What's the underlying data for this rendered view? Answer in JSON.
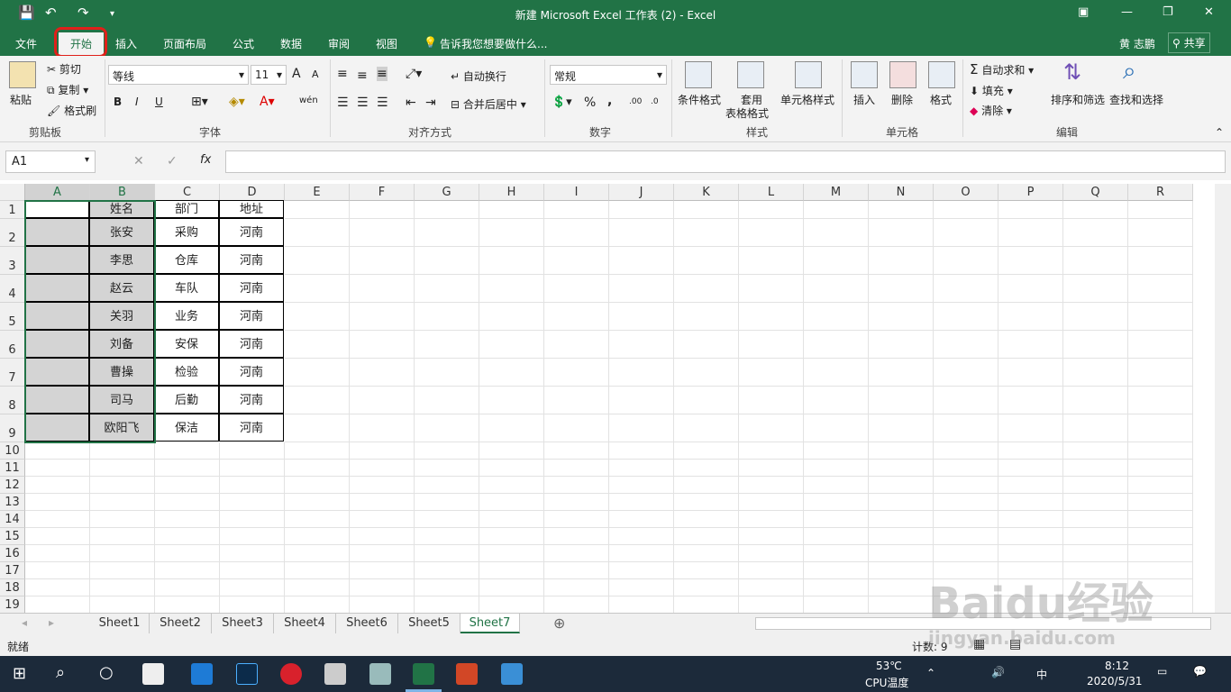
{
  "window": {
    "title": "新建 Microsoft Excel 工作表 (2) - Excel",
    "user": "黄 志鹏",
    "share": "共享"
  },
  "tabs": [
    "文件",
    "开始",
    "插入",
    "页面布局",
    "公式",
    "数据",
    "审阅",
    "视图"
  ],
  "tell_me": "告诉我您想要做什么...",
  "ribbon": {
    "clipboard": {
      "label": "剪贴板",
      "paste": "粘贴",
      "cut": "剪切",
      "copy": "复制",
      "format_painter": "格式刷"
    },
    "font": {
      "label": "字体",
      "name": "等线",
      "size": "11",
      "bold": "B",
      "italic": "I",
      "underline": "U",
      "grow": "A",
      "shrink": "A",
      "phonetic": "wén"
    },
    "alignment": {
      "label": "对齐方式",
      "wrap": "自动换行",
      "merge": "合并后居中"
    },
    "number": {
      "label": "数字",
      "format": "常规",
      "percent": "%",
      "comma": ",",
      "inc": ".00",
      "dec": ".0"
    },
    "styles": {
      "label": "样式",
      "conditional": "条件格式",
      "table": "套用",
      "table2": "表格格式",
      "cell": "单元格样式"
    },
    "cells": {
      "label": "单元格",
      "insert": "插入",
      "delete": "删除",
      "format": "格式"
    },
    "editing": {
      "label": "编辑",
      "autosum": "自动求和",
      "fill": "填充",
      "clear": "清除",
      "sort": "排序和筛选",
      "find": "查找和选择"
    }
  },
  "formula": {
    "namebox": "A1",
    "fx": "fx",
    "value": ""
  },
  "columns": [
    "A",
    "B",
    "C",
    "D",
    "E",
    "F",
    "G",
    "H",
    "I",
    "J",
    "K",
    "L",
    "M",
    "N",
    "O",
    "P",
    "Q",
    "R"
  ],
  "rows": [
    "1",
    "2",
    "3",
    "4",
    "5",
    "6",
    "7",
    "8",
    "9",
    "10",
    "11",
    "12",
    "13",
    "14",
    "15",
    "16",
    "17",
    "18",
    "19"
  ],
  "table": {
    "header": [
      "",
      "姓名",
      "部门",
      "地址"
    ],
    "rows": [
      [
        "",
        "张安",
        "采购",
        "河南"
      ],
      [
        "",
        "李思",
        "仓库",
        "河南"
      ],
      [
        "",
        "赵云",
        "车队",
        "河南"
      ],
      [
        "",
        "关羽",
        "业务",
        "河南"
      ],
      [
        "",
        "刘备",
        "安保",
        "河南"
      ],
      [
        "",
        "曹操",
        "检验",
        "河南"
      ],
      [
        "",
        "司马",
        "后勤",
        "河南"
      ],
      [
        "",
        "欧阳飞",
        "保洁",
        "河南"
      ]
    ]
  },
  "sheets": [
    "Sheet1",
    "Sheet2",
    "Sheet3",
    "Sheet4",
    "Sheet6",
    "Sheet5",
    "Sheet7"
  ],
  "active_sheet": "Sheet7",
  "status": {
    "ready": "就绪",
    "count": "计数: 9"
  },
  "taskbar": {
    "temp": "53℃",
    "temp_label": "CPU温度",
    "ime": "中",
    "time": "8:12",
    "date": "2020/5/31"
  },
  "watermark": "Baidu经验",
  "watermark_sub": "jingyan.baidu.com",
  "colors": {
    "excel_green": "#217346",
    "selection": "#d4d4d4",
    "highlight": "#e0201a"
  }
}
